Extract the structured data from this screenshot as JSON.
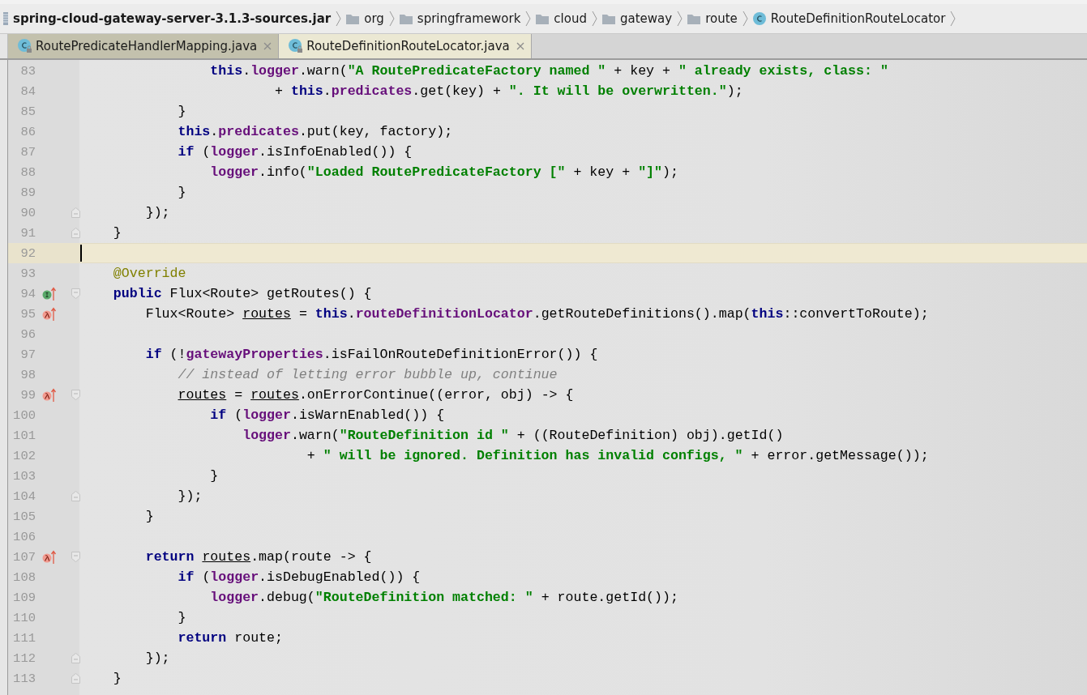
{
  "breadcrumb": [
    {
      "kind": "jar",
      "label": "spring-cloud-gateway-server-3.1.3-sources.jar"
    },
    {
      "kind": "folder",
      "label": "org"
    },
    {
      "kind": "folder",
      "label": "springframework"
    },
    {
      "kind": "folder",
      "label": "cloud"
    },
    {
      "kind": "folder",
      "label": "gateway"
    },
    {
      "kind": "folder",
      "label": "route"
    },
    {
      "kind": "class",
      "label": "RouteDefinitionRouteLocator"
    }
  ],
  "tabs": [
    {
      "label": "RoutePredicateHandlerMapping.java",
      "selected": false
    },
    {
      "label": "RouteDefinitionRouteLocator.java",
      "selected": true
    }
  ],
  "lines": [
    {
      "number": "83",
      "current": false,
      "tokens": [
        {
          "kind": "keyword",
          "text": "                this"
        },
        {
          "kind": "plain",
          "text": "."
        },
        {
          "kind": "field",
          "text": "logger"
        },
        {
          "kind": "plain",
          "text": ".warn("
        },
        {
          "kind": "string",
          "text": "\"A RoutePredicateFactory named \""
        },
        {
          "kind": "plain",
          "text": " + key + "
        },
        {
          "kind": "string",
          "text": "\" already exists, class: \""
        }
      ]
    },
    {
      "number": "84",
      "current": false,
      "tokens": [
        {
          "kind": "plain",
          "text": "                        + "
        },
        {
          "kind": "keyword",
          "text": "this"
        },
        {
          "kind": "plain",
          "text": "."
        },
        {
          "kind": "field",
          "text": "predicates"
        },
        {
          "kind": "plain",
          "text": ".get(key) + "
        },
        {
          "kind": "string",
          "text": "\". It will be overwritten.\""
        },
        {
          "kind": "plain",
          "text": ");"
        }
      ]
    },
    {
      "number": "85",
      "current": false,
      "tokens": [
        {
          "kind": "plain",
          "text": "            }"
        }
      ]
    },
    {
      "number": "86",
      "current": false,
      "tokens": [
        {
          "kind": "keyword",
          "text": "            this"
        },
        {
          "kind": "plain",
          "text": "."
        },
        {
          "kind": "field",
          "text": "predicates"
        },
        {
          "kind": "plain",
          "text": ".put(key, factory);"
        }
      ]
    },
    {
      "number": "87",
      "current": false,
      "tokens": [
        {
          "kind": "keyword",
          "text": "            if"
        },
        {
          "kind": "plain",
          "text": " ("
        },
        {
          "kind": "field",
          "text": "logger"
        },
        {
          "kind": "plain",
          "text": ".isInfoEnabled()) {"
        }
      ]
    },
    {
      "number": "88",
      "current": false,
      "tokens": [
        {
          "kind": "field",
          "text": "                logger"
        },
        {
          "kind": "plain",
          "text": ".info("
        },
        {
          "kind": "string",
          "text": "\"Loaded RoutePredicateFactory [\""
        },
        {
          "kind": "plain",
          "text": " + key + "
        },
        {
          "kind": "string",
          "text": "\"]\""
        },
        {
          "kind": "plain",
          "text": ");"
        }
      ]
    },
    {
      "number": "89",
      "current": false,
      "tokens": [
        {
          "kind": "plain",
          "text": "            }"
        }
      ]
    },
    {
      "number": "90",
      "current": false,
      "gutter": [
        {
          "kind": "fold_end"
        }
      ],
      "tokens": [
        {
          "kind": "plain",
          "text": "        });"
        }
      ]
    },
    {
      "number": "91",
      "current": false,
      "gutter": [
        {
          "kind": "fold_end"
        }
      ],
      "tokens": [
        {
          "kind": "plain",
          "text": "    }"
        }
      ]
    },
    {
      "number": "92",
      "current": true
    },
    {
      "number": "93",
      "current": false,
      "tokens": [
        {
          "kind": "annotation",
          "text": "    @Override"
        }
      ]
    },
    {
      "number": "94",
      "current": false,
      "gutter": [
        {
          "kind": "implementing"
        },
        {
          "kind": "fold_start"
        }
      ],
      "tokens": [
        {
          "kind": "keyword",
          "text": "    public"
        },
        {
          "kind": "plain",
          "text": " Flux<Route> getRoutes() {"
        }
      ]
    },
    {
      "number": "95",
      "current": false,
      "gutter": [
        {
          "kind": "lambda"
        }
      ],
      "tokens": [
        {
          "kind": "plain",
          "text": "        Flux<Route> "
        },
        {
          "kind": "reassigned",
          "text": "routes"
        },
        {
          "kind": "plain",
          "text": " = "
        },
        {
          "kind": "keyword",
          "text": "this"
        },
        {
          "kind": "plain",
          "text": "."
        },
        {
          "kind": "field",
          "text": "routeDefinitionLocator"
        },
        {
          "kind": "plain",
          "text": ".getRouteDefinitions().map("
        },
        {
          "kind": "keyword",
          "text": "this"
        },
        {
          "kind": "plain",
          "text": "::convertToRoute);"
        }
      ]
    },
    {
      "number": "96",
      "current": false
    },
    {
      "number": "97",
      "current": false,
      "tokens": [
        {
          "kind": "keyword",
          "text": "        if"
        },
        {
          "kind": "plain",
          "text": " (!"
        },
        {
          "kind": "field",
          "text": "gatewayProperties"
        },
        {
          "kind": "plain",
          "text": ".isFailOnRouteDefinitionError()) {"
        }
      ]
    },
    {
      "number": "98",
      "current": false,
      "tokens": [
        {
          "kind": "comment",
          "text": "            // instead of letting error bubble up, continue"
        }
      ]
    },
    {
      "number": "99",
      "current": false,
      "gutter": [
        {
          "kind": "lambda"
        },
        {
          "kind": "fold_start"
        }
      ],
      "tokens": [
        {
          "kind": "reassigned",
          "text": "            routes"
        },
        {
          "kind": "plain",
          "text": " = "
        },
        {
          "kind": "reassigned",
          "text": "routes"
        },
        {
          "kind": "plain",
          "text": ".onErrorContinue((error, obj) -> {"
        }
      ]
    },
    {
      "number": "100",
      "current": false,
      "tokens": [
        {
          "kind": "keyword",
          "text": "                if"
        },
        {
          "kind": "plain",
          "text": " ("
        },
        {
          "kind": "field",
          "text": "logger"
        },
        {
          "kind": "plain",
          "text": ".isWarnEnabled()) {"
        }
      ]
    },
    {
      "number": "101",
      "current": false,
      "tokens": [
        {
          "kind": "field",
          "text": "                    logger"
        },
        {
          "kind": "plain",
          "text": ".warn("
        },
        {
          "kind": "string",
          "text": "\"RouteDefinition id \""
        },
        {
          "kind": "plain",
          "text": " + ((RouteDefinition) obj).getId()"
        }
      ]
    },
    {
      "number": "102",
      "current": false,
      "tokens": [
        {
          "kind": "plain",
          "text": "                            + "
        },
        {
          "kind": "string",
          "text": "\" will be ignored. Definition has invalid configs, \""
        },
        {
          "kind": "plain",
          "text": " + error.getMessage());"
        }
      ]
    },
    {
      "number": "103",
      "current": false,
      "tokens": [
        {
          "kind": "plain",
          "text": "                }"
        }
      ]
    },
    {
      "number": "104",
      "current": false,
      "gutter": [
        {
          "kind": "fold_end"
        }
      ],
      "tokens": [
        {
          "kind": "plain",
          "text": "            });"
        }
      ]
    },
    {
      "number": "105",
      "current": false,
      "tokens": [
        {
          "kind": "plain",
          "text": "        }"
        }
      ]
    },
    {
      "number": "106",
      "current": false
    },
    {
      "number": "107",
      "current": false,
      "gutter": [
        {
          "kind": "lambda"
        },
        {
          "kind": "fold_start"
        }
      ],
      "tokens": [
        {
          "kind": "keyword",
          "text": "        return"
        },
        {
          "kind": "reassigned",
          "text": " routes"
        },
        {
          "kind": "plain",
          "text": ".map(route -> {"
        }
      ]
    },
    {
      "number": "108",
      "current": false,
      "tokens": [
        {
          "kind": "keyword",
          "text": "            if"
        },
        {
          "kind": "plain",
          "text": " ("
        },
        {
          "kind": "field",
          "text": "logger"
        },
        {
          "kind": "plain",
          "text": ".isDebugEnabled()) {"
        }
      ]
    },
    {
      "number": "109",
      "current": false,
      "tokens": [
        {
          "kind": "field",
          "text": "                logger"
        },
        {
          "kind": "plain",
          "text": ".debug("
        },
        {
          "kind": "string",
          "text": "\"RouteDefinition matched: \""
        },
        {
          "kind": "plain",
          "text": " + route.getId());"
        }
      ]
    },
    {
      "number": "110",
      "current": false,
      "tokens": [
        {
          "kind": "plain",
          "text": "            }"
        }
      ]
    },
    {
      "number": "111",
      "current": false,
      "tokens": [
        {
          "kind": "keyword",
          "text": "            return"
        },
        {
          "kind": "plain",
          "text": " route;"
        }
      ]
    },
    {
      "number": "112",
      "current": false,
      "gutter": [
        {
          "kind": "fold_end"
        }
      ],
      "tokens": [
        {
          "kind": "plain",
          "text": "        });"
        }
      ]
    },
    {
      "number": "113",
      "current": false,
      "gutter": [
        {
          "kind": "fold_end"
        }
      ],
      "tokens": [
        {
          "kind": "plain",
          "text": "    }"
        }
      ]
    }
  ]
}
